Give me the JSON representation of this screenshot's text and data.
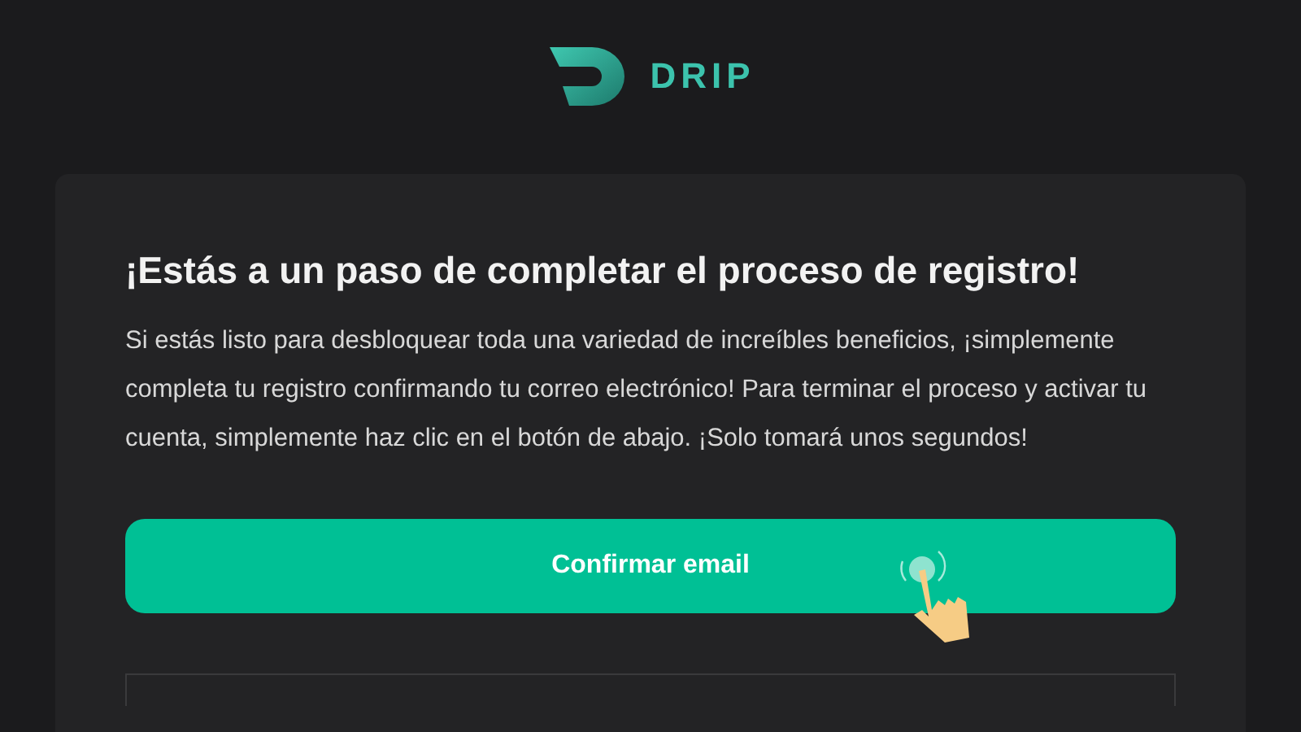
{
  "logo": {
    "text": "DRIP"
  },
  "card": {
    "title": "¡Estás a un paso de completar el proceso de registro!",
    "body": "Si estás listo para desbloquear toda una variedad de increíbles beneficios, ¡simplemente completa tu registro confirmando tu correo electrónico! Para terminar el proceso y activar tu cuenta, simplemente haz clic en el botón de abajo. ¡Solo tomará unos segundos!",
    "button": "Confirmar email"
  }
}
